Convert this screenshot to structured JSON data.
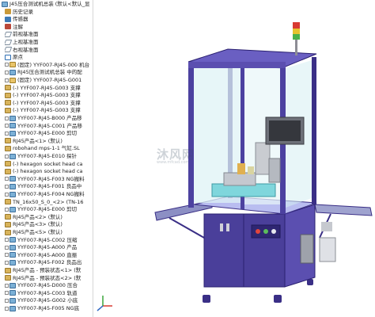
{
  "tree": {
    "items": [
      {
        "label": "J45压合测试机总装  (默认<默认_显",
        "icon": "assembly-root-icon",
        "indent": 0
      },
      {
        "label": "历史记录",
        "icon": "history-icon",
        "indent": 1
      },
      {
        "label": "传感器",
        "icon": "sensor-icon",
        "indent": 1
      },
      {
        "label": "注解",
        "icon": "annotation-icon",
        "indent": 1
      },
      {
        "label": "前视基准面",
        "icon": "plane-icon",
        "indent": 1
      },
      {
        "label": "上视基准面",
        "icon": "plane-icon",
        "indent": 1
      },
      {
        "label": "右视基准面",
        "icon": "plane-icon",
        "indent": 1
      },
      {
        "label": "原点",
        "icon": "origin-icon",
        "indent": 1
      },
      {
        "label": "(固定) YYF007-RJ45-000   机台",
        "icon": "fixed-part-icon",
        "indent": 1
      },
      {
        "label": "RJ45压合测试机总装 中的配",
        "icon": "assembly-icon",
        "indent": 1
      },
      {
        "label": "(固定) YYF007-RJ45-G001",
        "icon": "fixed-part-icon",
        "indent": 1
      },
      {
        "label": "(-) YYF007-RJ45-G003   支撑",
        "icon": "part-icon",
        "indent": 1
      },
      {
        "label": "(-) YYF007-RJ45-G003   支撑",
        "icon": "part-icon",
        "indent": 1
      },
      {
        "label": "(-) YYF007-RJ45-G003   支撑",
        "icon": "part-icon",
        "indent": 1
      },
      {
        "label": "(-) YYF007-RJ45-G003   支撑",
        "icon": "part-icon",
        "indent": 1
      },
      {
        "label": "YYF007-RJ45-B000   产品移",
        "icon": "assembly-icon",
        "indent": 1
      },
      {
        "label": "YYF007-RJ45-C001   产品移",
        "icon": "assembly-icon",
        "indent": 1
      },
      {
        "label": "YYF007-RJ45-E000   剪切",
        "icon": "assembly-icon",
        "indent": 1
      },
      {
        "label": "RJ45产品<1> (默认)",
        "icon": "part-icon",
        "indent": 1
      },
      {
        "label": "robohand mps-1-1 气缸.SL",
        "icon": "part-icon",
        "indent": 1
      },
      {
        "label": "YYF007-RJ45-E010   探针",
        "icon": "assembly-icon",
        "indent": 1
      },
      {
        "label": "(-) hexagon socket head ca",
        "icon": "part-icon",
        "indent": 1
      },
      {
        "label": "(-) hexagon socket head ca",
        "icon": "part-icon",
        "indent": 1
      },
      {
        "label": "YYF007-RJ45-F003 NG搬料",
        "icon": "assembly-icon",
        "indent": 1
      },
      {
        "label": "YYF007-RJ45-F001   良品中",
        "icon": "assembly-icon",
        "indent": 1
      },
      {
        "label": "YYF007-RJ45-F004   NG搬料",
        "icon": "assembly-icon",
        "indent": 1
      },
      {
        "label": "TN_16x50_S_0_<2> (TN-16",
        "icon": "part-icon",
        "indent": 1
      },
      {
        "label": "YYF007-RJ45-E000   剪切",
        "icon": "assembly-icon",
        "indent": 1
      },
      {
        "label": "RJ45产品<2> (默认)",
        "icon": "part-icon",
        "indent": 1
      },
      {
        "label": "RJ45产品<3> (默认)",
        "icon": "part-icon",
        "indent": 1
      },
      {
        "label": "RJ45产品<5> (默认)",
        "icon": "part-icon",
        "indent": 1
      },
      {
        "label": "YYF007-RJ45-C002   压缩",
        "icon": "assembly-icon",
        "indent": 1
      },
      {
        "label": "YYF007-RJ45-A000   产品",
        "icon": "assembly-icon",
        "indent": 1
      },
      {
        "label": "YYF007-RJ45-A000   直振",
        "icon": "assembly-icon",
        "indent": 1
      },
      {
        "label": "YYF007-RJ45-F002   良品出",
        "icon": "assembly-icon",
        "indent": 1
      },
      {
        "label": "RJ45产品 - 预装状态<1> (默",
        "icon": "part-icon",
        "indent": 1
      },
      {
        "label": "RJ45产品 - 预装状态<2> (默",
        "icon": "part-icon",
        "indent": 1
      },
      {
        "label": "YYF007-RJ45-D000   压合",
        "icon": "assembly-icon",
        "indent": 1
      },
      {
        "label": "YYF007-RJ45-C003   轨道",
        "icon": "assembly-icon",
        "indent": 1
      },
      {
        "label": "YYF007-RJ45-G002   小底",
        "icon": "assembly-icon",
        "indent": 1
      },
      {
        "label": "YYF007-RJ45-F005   NG底",
        "icon": "assembly-icon",
        "indent": 1
      }
    ]
  },
  "viewport": {
    "watermark": "沐风网",
    "watermark_sub": "www.mfcad.com"
  },
  "colors": {
    "frame": "#5b4fb0",
    "frame_dark": "#3a2f86",
    "cabinet": "#4a3f9a",
    "glass": "#dff3f6",
    "tray": "#7fd6dc",
    "steel": "#c9ccd1"
  }
}
